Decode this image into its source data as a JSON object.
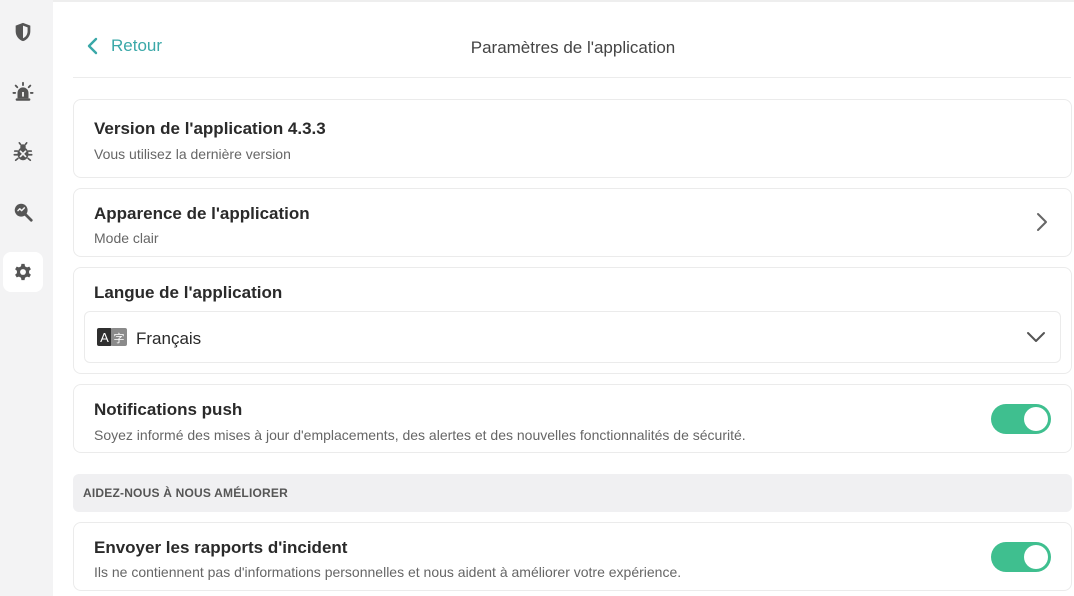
{
  "sidebar": {
    "items": [
      {
        "icon": "shield-icon",
        "active": false
      },
      {
        "icon": "alarm-icon",
        "active": false
      },
      {
        "icon": "bug-icon",
        "active": false
      },
      {
        "icon": "search-scan-icon",
        "active": false
      },
      {
        "icon": "gear-icon",
        "active": true
      }
    ]
  },
  "header": {
    "back_label": "Retour",
    "title": "Paramètres de l'application"
  },
  "version": {
    "title": "Version de l'application 4.3.3",
    "subtitle": "Vous utilisez la dernière version"
  },
  "appearance": {
    "title": "Apparence de l'application",
    "subtitle": "Mode clair"
  },
  "language": {
    "title": "Langue de l'application",
    "selected": "Français"
  },
  "notifications": {
    "title": "Notifications push",
    "subtitle": "Soyez informé des mises à jour d'emplacements, des alertes et des nouvelles fonctionnalités de sécurité.",
    "enabled": true
  },
  "improve_section": {
    "label": "AIDEZ-NOUS À NOUS AMÉLIORER"
  },
  "crash_reports": {
    "title": "Envoyer les rapports d'incident",
    "subtitle": "Ils ne contiennent pas d'informations personnelles et nous aident à améliorer votre expérience.",
    "enabled": true
  },
  "colors": {
    "accent": "#3aa8a8",
    "toggle_on": "#3fbf8f",
    "sidebar_bg": "#f3f3f4"
  }
}
